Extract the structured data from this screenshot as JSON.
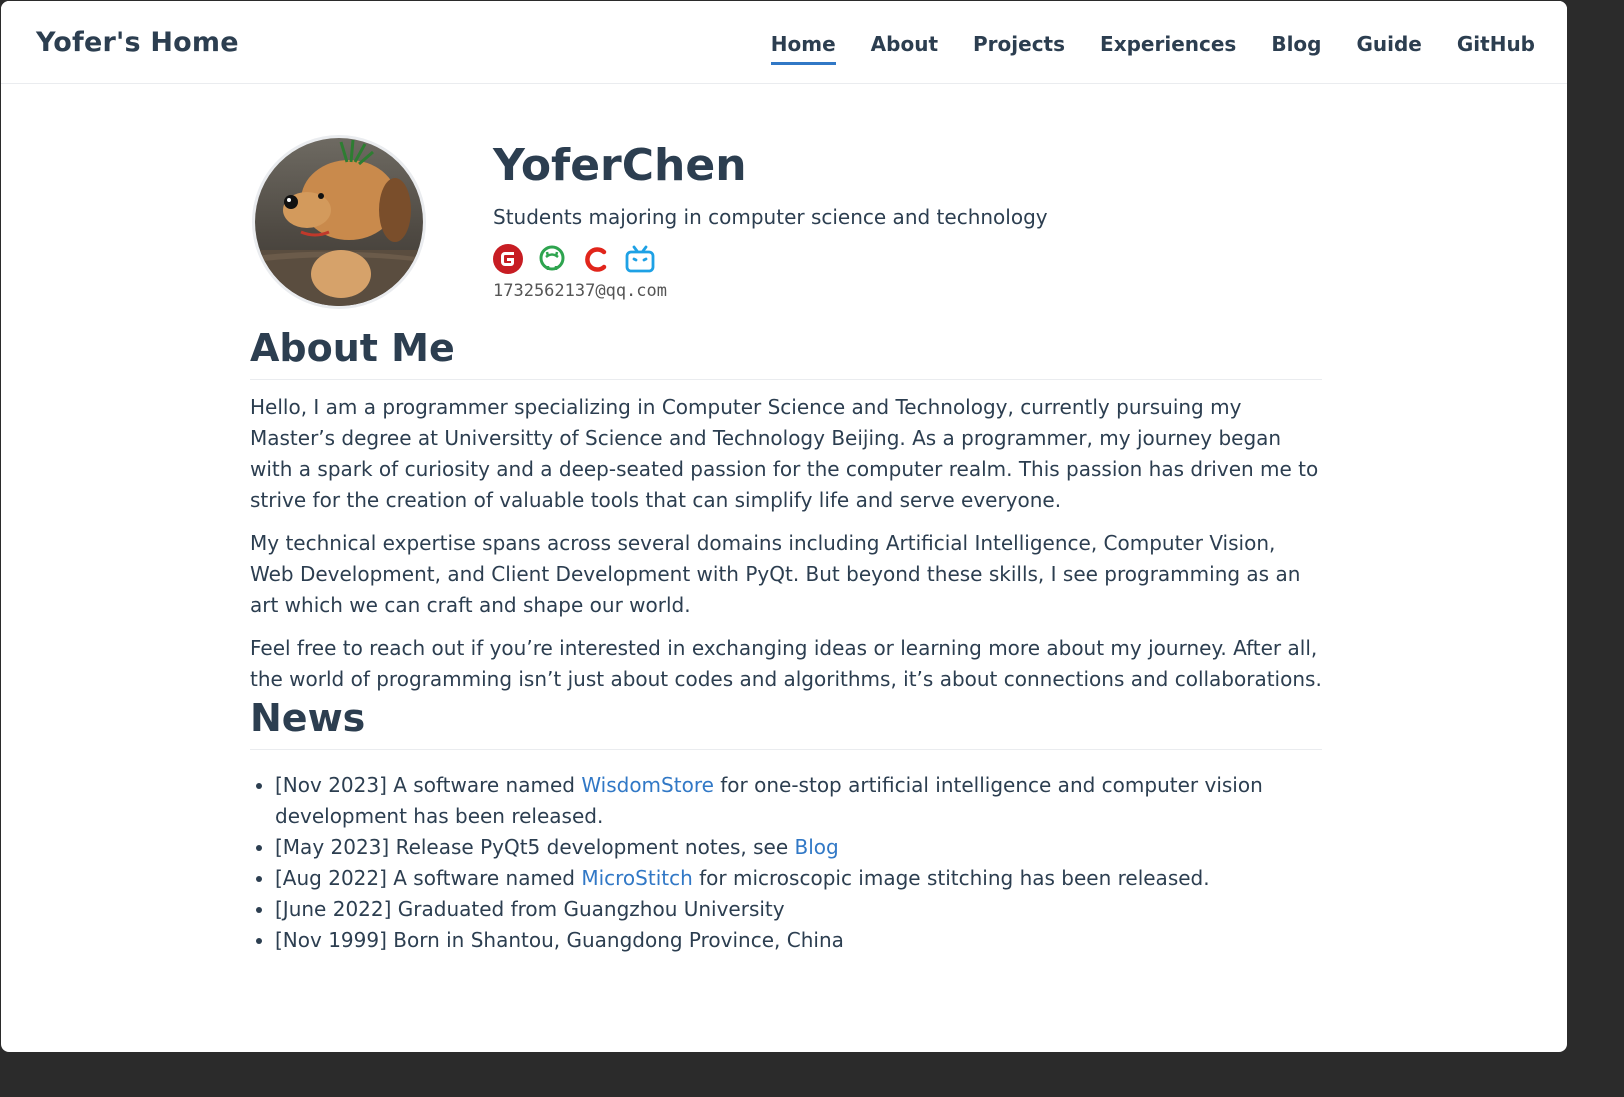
{
  "header": {
    "brand": "Yofer's Home",
    "nav": [
      "Home",
      "About",
      "Projects",
      "Experiences",
      "Blog",
      "Guide",
      "GitHub"
    ],
    "active": "Home"
  },
  "profile": {
    "name": "YoferChen",
    "tagline": "Students majoring in computer science and technology",
    "email": "1732562137@qq.com",
    "social_icons": [
      {
        "name": "gitee-icon",
        "color": "#c71d23"
      },
      {
        "name": "github-icon",
        "color": "#2ea44f"
      },
      {
        "name": "csdn-icon",
        "color": "#e1251b"
      },
      {
        "name": "bilibili-icon",
        "color": "#1ea1e5"
      }
    ]
  },
  "about": {
    "heading": "About Me",
    "paragraphs": [
      "Hello, I am a programmer specializing in Computer Science and Technology, currently pursuing my Master’s degree at Universitty of Science and Technology Beijing. As a programmer, my journey began with a spark of curiosity and a deep-seated passion for the computer realm. This passion has driven me to strive for the creation of valuable tools that can simplify life and serve everyone.",
      "My technical expertise spans across several domains including Artificial Intelligence, Computer Vision, Web Development, and Client Development with PyQt. But beyond these skills, I see programming as an art which we can craft and shape our world.",
      "Feel free to reach out if you’re interested in exchanging ideas or learning more about my journey. After all, the world of programming isn’t just about codes and algorithms, it’s about connections and collaborations."
    ]
  },
  "news": {
    "heading": "News",
    "items": [
      {
        "pre": "[Nov 2023] A software named ",
        "link": "WisdomStore",
        "post": " for one-stop artificial intelligence and computer vision development has been released."
      },
      {
        "pre": "[May 2023] Release PyQt5 development notes, see ",
        "link": "Blog",
        "post": ""
      },
      {
        "pre": "[Aug 2022] A software named ",
        "link": "MicroStitch",
        "post": " for microscopic image stitching has been released."
      },
      {
        "pre": "[June 2022] Graduated from Guangzhou University",
        "link": "",
        "post": ""
      },
      {
        "pre": "[Nov 1999] Born in Shantou, Guangdong Province, China",
        "link": "",
        "post": ""
      }
    ]
  },
  "colors": {
    "accent": "#3178c6",
    "text": "#2c3e50"
  }
}
